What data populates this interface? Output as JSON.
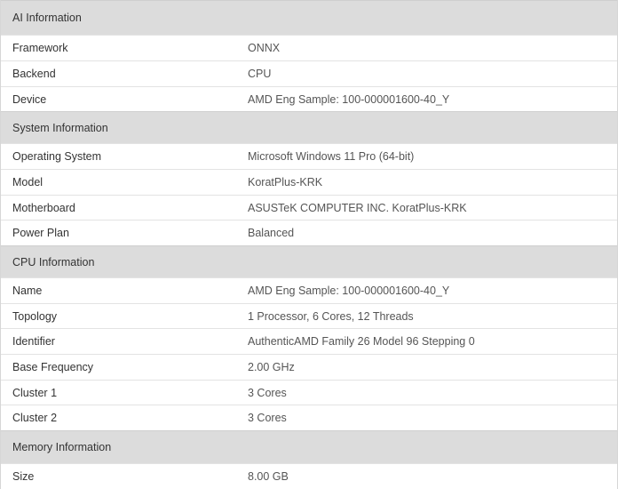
{
  "sections": [
    {
      "title": "AI Information",
      "rows": [
        {
          "label": "Framework",
          "value": "ONNX"
        },
        {
          "label": "Backend",
          "value": "CPU"
        },
        {
          "label": "Device",
          "value": "AMD Eng Sample: 100-000001600-40_Y"
        }
      ]
    },
    {
      "title": "System Information",
      "rows": [
        {
          "label": "Operating System",
          "value": "Microsoft Windows 11 Pro (64-bit)"
        },
        {
          "label": "Model",
          "value": "KoratPlus-KRK"
        },
        {
          "label": "Motherboard",
          "value": "ASUSTeK COMPUTER INC. KoratPlus-KRK"
        },
        {
          "label": "Power Plan",
          "value": "Balanced"
        }
      ]
    },
    {
      "title": "CPU Information",
      "rows": [
        {
          "label": "Name",
          "value": "AMD Eng Sample: 100-000001600-40_Y"
        },
        {
          "label": "Topology",
          "value": "1 Processor, 6 Cores, 12 Threads"
        },
        {
          "label": "Identifier",
          "value": "AuthenticAMD Family 26 Model 96 Stepping 0"
        },
        {
          "label": "Base Frequency",
          "value": "2.00 GHz"
        },
        {
          "label": "Cluster 1",
          "value": "3 Cores"
        },
        {
          "label": "Cluster 2",
          "value": "3 Cores"
        }
      ]
    },
    {
      "title": "Memory Information",
      "rows": [
        {
          "label": "Size",
          "value": "8.00 GB"
        }
      ]
    }
  ],
  "colors": {
    "header_bg": "#dcdcdc",
    "row_bg": "#ffffff",
    "divider": "#e3e3e3",
    "label_text": "#333333",
    "value_text": "#555555"
  }
}
